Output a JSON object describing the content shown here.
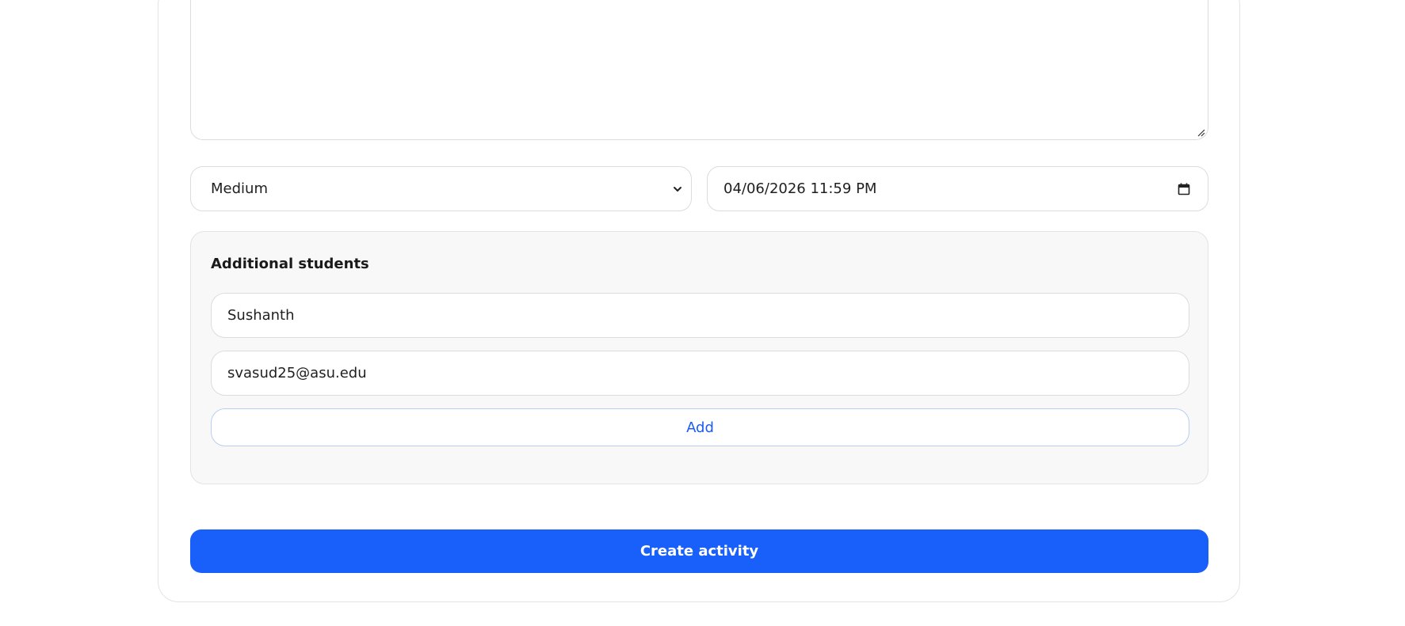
{
  "form": {
    "priority": {
      "value": "Medium",
      "icon": "chevron-down-icon"
    },
    "due_date": {
      "value": "04/06/2026 11:59 PM",
      "icon": "calendar-icon"
    },
    "additional_students": {
      "title": "Additional students",
      "name_value": "Sushanth",
      "email_value": "svasud25@asu.edu",
      "add_label": "Add"
    },
    "submit_label": "Create activity"
  },
  "colors": {
    "primary": "#195ffa",
    "add_text": "#1a5cf5",
    "panel_bg": "#f8f8f8",
    "border": "#dcdcdc"
  }
}
